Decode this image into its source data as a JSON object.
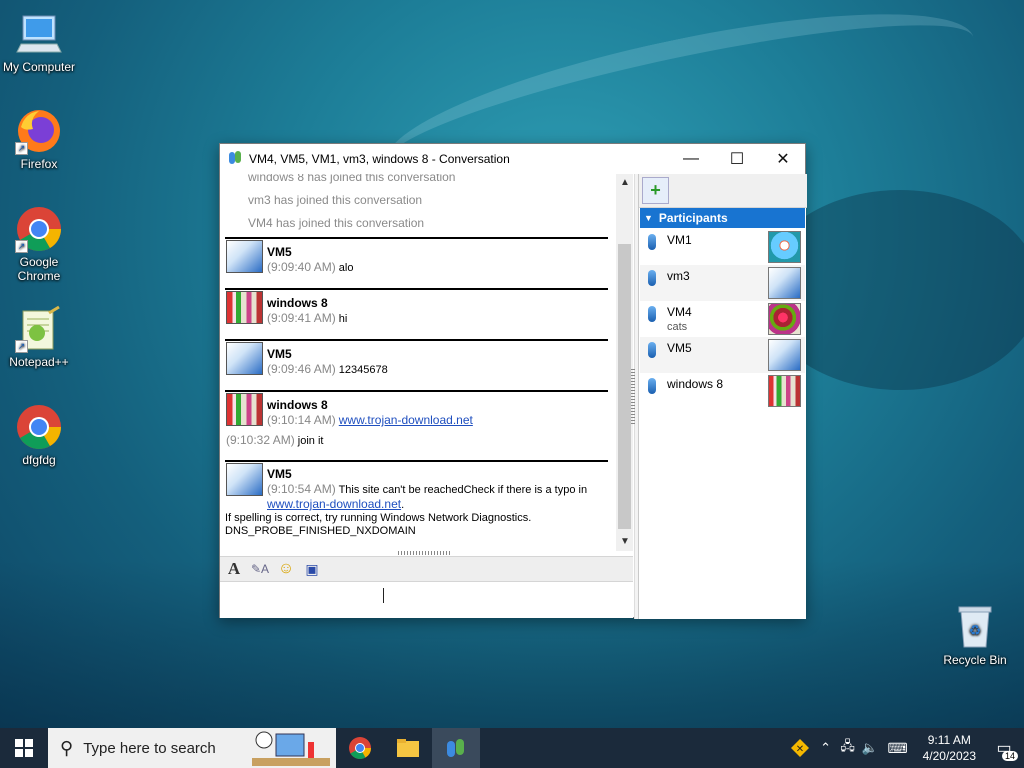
{
  "desktop": {
    "icons": [
      {
        "label": "My Computer"
      },
      {
        "label": "Firefox"
      },
      {
        "label": "Google Chrome"
      },
      {
        "label": "Notepad++"
      },
      {
        "label": "dfgfdg"
      },
      {
        "label": "Recycle Bin"
      }
    ]
  },
  "window": {
    "title": "VM4, VM5, VM1, vm3, windows 8 - Conversation",
    "system_messages": [
      "windows 8 has joined this conversation",
      "vm3 has joined this conversation",
      "VM4 has joined this conversation"
    ],
    "messages": [
      {
        "sender": "VM5",
        "time": "(9:09:40 AM)",
        "text": "alo"
      },
      {
        "sender": "windows 8",
        "time": "(9:09:41 AM)",
        "text": "hi"
      },
      {
        "sender": "VM5",
        "time": "(9:09:46 AM)",
        "text": "12345678"
      },
      {
        "sender": "windows 8",
        "time": "(9:10:14 AM)",
        "link": "www.trojan-download.net",
        "followup_time": "(9:10:32 AM)",
        "followup_text": "join it"
      },
      {
        "sender": "VM5",
        "time": "(9:10:54 AM)",
        "text": "This site can't be reachedCheck if there is a typo in",
        "link": "www.trojan-download.net",
        "link_suffix": ".",
        "line3": "If spelling is correct, try running Windows Network Diagnostics.",
        "line4": "DNS_PROBE_FINISHED_NXDOMAIN"
      }
    ],
    "participants_header": "Participants",
    "participants": [
      {
        "name": "VM1",
        "status": ""
      },
      {
        "name": "vm3",
        "status": ""
      },
      {
        "name": "VM4",
        "status": "cats"
      },
      {
        "name": "VM5",
        "status": ""
      },
      {
        "name": "windows 8",
        "status": ""
      }
    ]
  },
  "taskbar": {
    "search_placeholder": "Type here to search",
    "time": "9:11 AM",
    "date": "4/20/2023",
    "notification_count": "14"
  }
}
